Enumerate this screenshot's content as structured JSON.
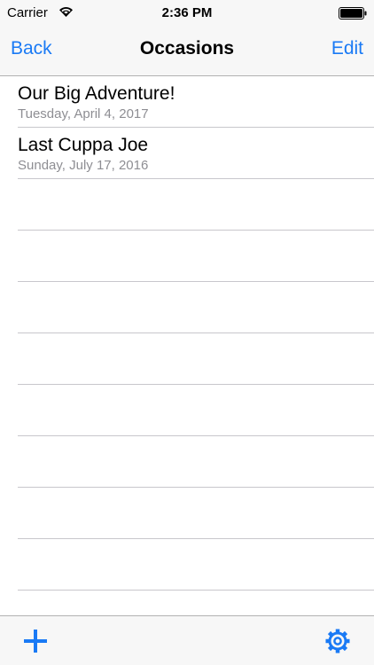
{
  "status_bar": {
    "carrier": "Carrier",
    "time": "2:36 PM",
    "icons": [
      "wifi-icon",
      "battery-icon"
    ]
  },
  "nav": {
    "back_label": "Back",
    "title": "Occasions",
    "edit_label": "Edit"
  },
  "occasions": [
    {
      "title": "Our Big Adventure!",
      "date": "Tuesday, April 4, 2017"
    },
    {
      "title": "Last Cuppa Joe",
      "date": "Sunday, July 17, 2016"
    }
  ],
  "toolbar": {
    "icons": [
      "plus-icon",
      "gear-icon"
    ]
  },
  "colors": {
    "accent": "#1a7af5",
    "bar_background": "#f7f7f7",
    "separator": "#c8c7cc",
    "subtitle": "#8e8e93"
  }
}
